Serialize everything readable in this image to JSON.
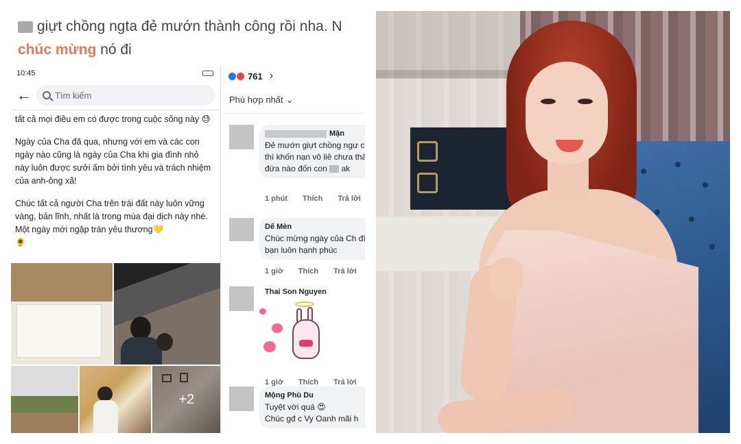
{
  "left": {
    "headline_line1": "giựt chồng ngta đẻ mướn thành công rồi nha. N",
    "headline_hl": "chúc mừng",
    "headline_tail": "nó đi",
    "phone": {
      "time": "10:45",
      "status_right": "",
      "search_placeholder": "Tìm kiếm",
      "paragraphs": [
        "tất cả mọi điều em có được trong cuộc sống này 😓",
        "Ngày của Cha đã qua, nhưng với em và các con ngày nào cũng là ngày của Cha khi gia đình nhỏ này luôn được sưởi ấm bởi tình yêu và trách nhiệm của anh-ông xã!",
        "Chúc tất cả người Cha trên trái đất này luôn vững vàng, bản lĩnh, nhất là trong mùa đại dịch này nhé. Một ngày mới ngập tràn yêu thương💛",
        "🌻"
      ],
      "more_photos": "+2"
    },
    "comments": {
      "reaction_count": "761",
      "sort_label": "Phù hợp nhất",
      "items": [
        {
          "name": "Mận",
          "text": "Đẻ mướn giựt chồng ngư cách thì khốn nạn vô liê chưa thấy đứa nào đốn con",
          "text_tail": "ak",
          "time": "1 phút",
          "like": "Thích",
          "reply": "Trả lời"
        },
        {
          "name": "Dế Mèn",
          "text": "Chúc mừng ngày của Ch đình bạn luôn hạnh phúc",
          "time": "1 giờ",
          "like": "Thích",
          "reply": "Trả lời"
        },
        {
          "name": "Thai Son Nguyen",
          "text": "",
          "time": "1 giờ",
          "like": "Thích",
          "reply": "Trả lời"
        },
        {
          "name": "Mộng Phù Du",
          "text": "Tuyệt vời quá 😍",
          "text2": "Chúc gđ c Vy Oanh mãi h",
          "time": "",
          "like": "",
          "reply": ""
        }
      ]
    }
  },
  "colors": {
    "headline_highlight": "#e07a55",
    "facebook_blue": "#1877f2",
    "love_red": "#f33e58",
    "chair_blue": "#2a5488",
    "hair_red": "#9b2f1d",
    "dress_pink": "#f1d1c7"
  },
  "icons": [
    "back-arrow-icon",
    "search-icon",
    "like-reaction-icon",
    "love-reaction-icon",
    "chevron-right-icon",
    "chevron-down-icon"
  ]
}
